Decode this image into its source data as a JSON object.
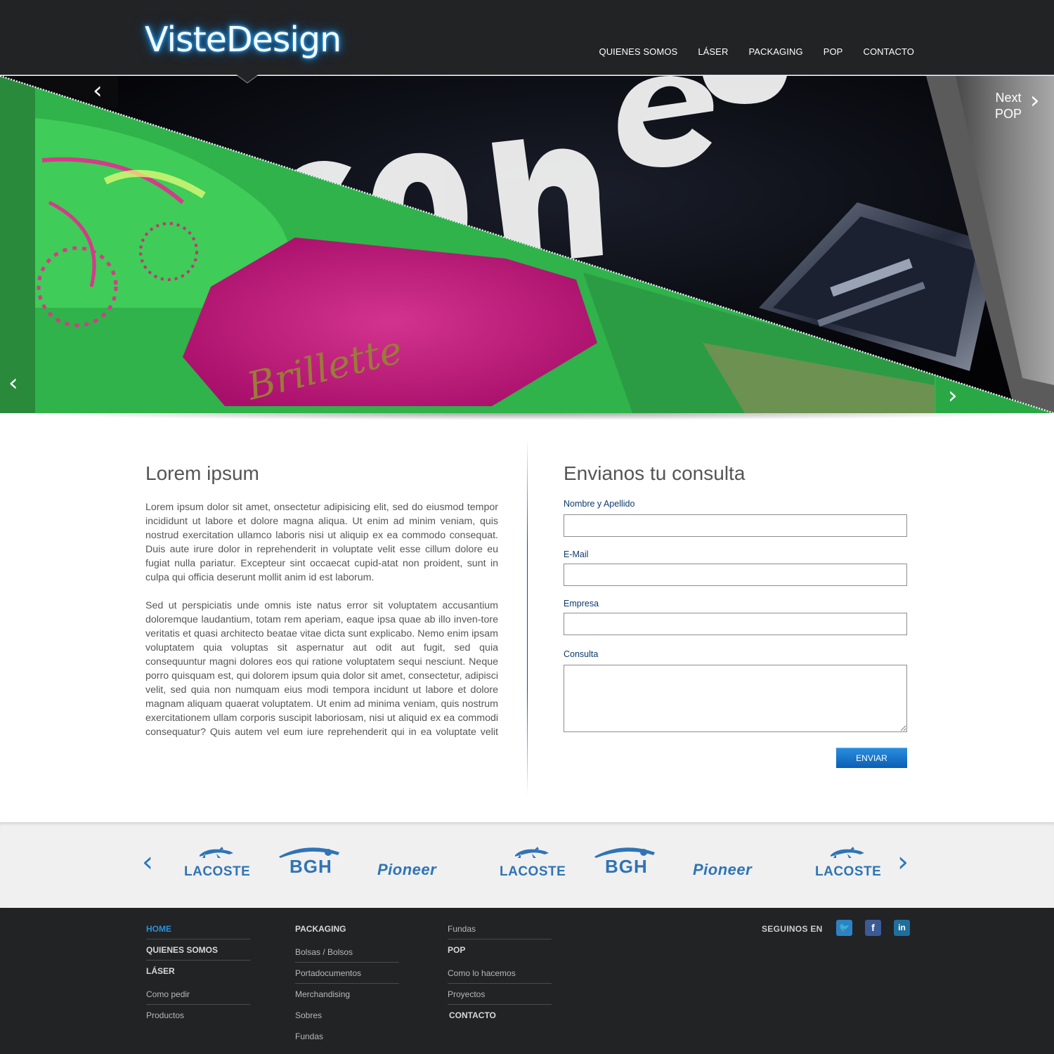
{
  "header": {
    "logo_text": "VisteDesign",
    "nav": [
      "QUIENES SOMOS",
      "LÁSER",
      "PACKAGING",
      "POP",
      "CONTACTO"
    ]
  },
  "slider": {
    "next_label": "Next",
    "next_category": "POP",
    "arrow_prev": "‹",
    "arrow_next": "›"
  },
  "main": {
    "left_title": "Lorem ipsum",
    "paragraph_1": "Lorem ipsum dolor sit amet, onsectetur adipisicing elit, sed do eiusmod tempor incididunt ut labore et dolore magna aliqua. Ut enim ad minim veniam, quis nostrud exercitation ullamco laboris nisi ut aliquip ex ea commodo consequat. Duis aute irure dolor in reprehenderit in voluptate velit esse cillum dolore eu fugiat nulla pariatur. Excepteur sint occaecat cupid-atat non proident, sunt in culpa qui officia deserunt mollit anim id est laborum.",
    "paragraph_2": "Sed ut perspiciatis unde omnis iste natus error sit voluptatem accusantium doloremque laudantium, totam rem aperiam, eaque ipsa quae ab illo inven-tore veritatis et quasi architecto beatae vitae dicta sunt explicabo. Nemo enim ipsam voluptatem quia voluptas sit aspernatur aut odit aut fugit, sed quia consequuntur magni dolores eos qui ratione voluptatem sequi nesciunt. Neque porro quisquam est, qui dolorem ipsum quia dolor sit amet, consectetur, adipisci velit, sed quia non numquam eius modi tempora incidunt ut labore et dolore magnam aliquam quaerat voluptatem. Ut enim ad minima veniam, quis nostrum exercitationem ullam corporis suscipit laboriosam, nisi ut aliquid ex ea commodi consequatur? Quis autem vel eum iure reprehenderit qui in ea voluptate velit esse quam nihil molestiae",
    "form_title": "Envianos tu consulta",
    "form": {
      "name_label": "Nombre y Apellido",
      "email_label": "E-Mail",
      "company_label": "Empresa",
      "query_label": "Consulta",
      "name_value": "",
      "email_value": "",
      "company_value": "",
      "query_value": "",
      "submit_label": "ENVIAR"
    }
  },
  "clients": {
    "logos": [
      "LACOSTE",
      "BGH",
      "Pioneer",
      "LACOSTE",
      "BGH",
      "Pioneer",
      "LACOSTE"
    ],
    "arrow_prev": "‹",
    "arrow_next": "›"
  },
  "footer": {
    "col1": [
      {
        "label": "HOME",
        "style": "active"
      },
      {
        "label": "QUIENES SOMOS",
        "style": "bold"
      },
      {
        "label": "LÁSER",
        "style": "bold"
      },
      {
        "label": "Como pedir",
        "style": "normal"
      },
      {
        "label": "Productos",
        "style": "normal"
      }
    ],
    "col2": [
      {
        "label": "PACKAGING",
        "style": "bold"
      },
      {
        "label": "Bolsas / Bolsos",
        "style": "normal"
      },
      {
        "label": "Portadocumentos",
        "style": "normal"
      },
      {
        "label": "Merchandising",
        "style": "normal"
      },
      {
        "label": "Sobres",
        "style": "normal"
      },
      {
        "label": "Fundas",
        "style": "normal"
      }
    ],
    "col3": [
      {
        "label": "Fundas",
        "style": "normal"
      },
      {
        "label": "POP",
        "style": "bold"
      },
      {
        "label": "Como lo hacemos",
        "style": "normal"
      },
      {
        "label": "Proyectos",
        "style": "normal"
      },
      {
        "label": "CONTACTO",
        "style": "bold"
      }
    ],
    "social_label": "SEGUINOS EN",
    "social": [
      {
        "name": "twitter",
        "glyph": "🐦",
        "color": "#2a83c6"
      },
      {
        "name": "facebook",
        "glyph": "f",
        "color": "#3b5a96"
      },
      {
        "name": "linkedin",
        "glyph": "in",
        "color": "#1f6f9d"
      }
    ]
  },
  "colors": {
    "header_bg": "#222325",
    "accent_blue": "#2c8fd8",
    "form_label": "#0e3b6e",
    "button": "#0a5fb4"
  }
}
